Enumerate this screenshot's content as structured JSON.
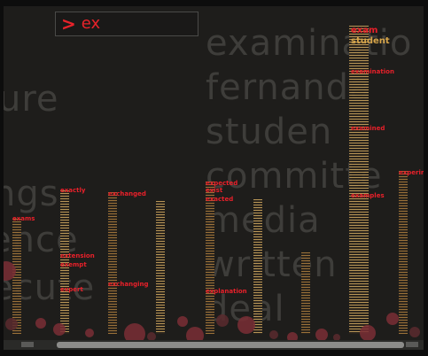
{
  "search": {
    "prompt": ">",
    "query": "ex"
  },
  "background_words": [
    "ure",
    "ngs",
    "ence",
    "ecute",
    "examinatio",
    "fernanda",
    "studen",
    "committe",
    "media",
    "written",
    "deal"
  ],
  "highlights": [
    "exam",
    "student",
    "examination",
    "examined",
    "examples",
    "experiment",
    "exactly",
    "exchanged",
    "exchanging",
    "expected",
    "exist",
    "exacted",
    "exams",
    "extension",
    "exempt",
    "expert",
    "explanation"
  ],
  "colors": {
    "accent": "#e8222a",
    "column": "#a87a3c",
    "bubble": "#7a2e35",
    "background": "#1e1d1b"
  }
}
